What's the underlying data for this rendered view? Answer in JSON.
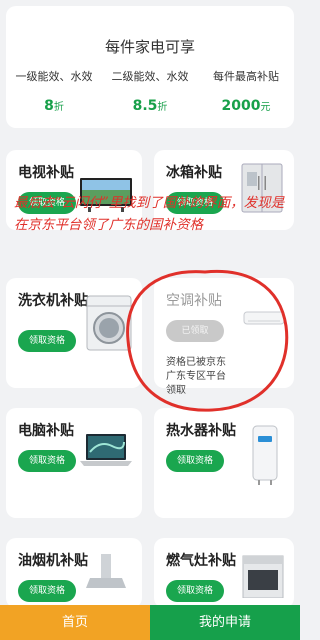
{
  "summary": {
    "title": "每件家电可享",
    "tiers": [
      {
        "label": "一级能效、水效",
        "value": "8",
        "unit": "折"
      },
      {
        "label": "二级能效、水效",
        "value": "8.5",
        "unit": "折"
      },
      {
        "label": "每件最高补贴",
        "value": "2000",
        "unit": "元"
      }
    ]
  },
  "subsidies": [
    {
      "title": "电视补贴",
      "button": "领取资格",
      "icon": "tv-icon"
    },
    {
      "title": "冰箱补贴",
      "button": "领取资格",
      "icon": "fridge-icon"
    },
    {
      "title": "洗衣机补贴",
      "button": "领取资格",
      "icon": "washing-machine-icon"
    },
    {
      "title": "空调补贴",
      "button": "已领取",
      "note": "资格已被京东\n广东专区平台\n领取",
      "icon": "air-conditioner-icon"
    },
    {
      "title": "电脑补贴",
      "button": "领取资格",
      "icon": "laptop-icon"
    },
    {
      "title": "热水器补贴",
      "button": "领取资格",
      "icon": "water-heater-icon"
    },
    {
      "title": "油烟机补贴",
      "button": "领取资格",
      "icon": "range-hood-icon"
    },
    {
      "title": "燃气灶补贴",
      "button": "领取资格",
      "icon": "gas-stove-icon"
    }
  ],
  "annotation": "最后去“云闪付”里找到了国补的界面，发现是在京东平台领了广东的国补资格",
  "tabs": {
    "home": "首页",
    "mine": "我的申请"
  },
  "colors": {
    "accent": "#1aa64f",
    "home_tab": "#f2a324",
    "annotation": "#e0302a"
  }
}
